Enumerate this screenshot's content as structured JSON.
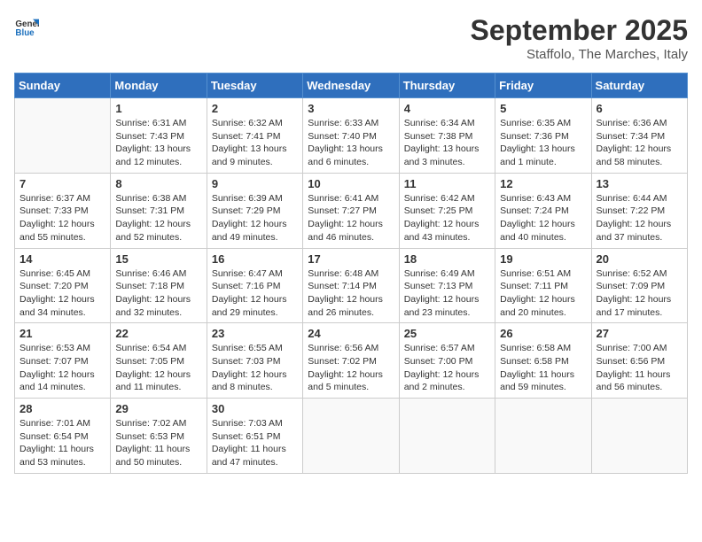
{
  "logo": {
    "general": "General",
    "blue": "Blue"
  },
  "header": {
    "month": "September 2025",
    "location": "Staffolo, The Marches, Italy"
  },
  "weekdays": [
    "Sunday",
    "Monday",
    "Tuesday",
    "Wednesday",
    "Thursday",
    "Friday",
    "Saturday"
  ],
  "weeks": [
    [
      {
        "day": "",
        "sunrise": "",
        "sunset": "",
        "daylight": ""
      },
      {
        "day": "1",
        "sunrise": "Sunrise: 6:31 AM",
        "sunset": "Sunset: 7:43 PM",
        "daylight": "Daylight: 13 hours and 12 minutes."
      },
      {
        "day": "2",
        "sunrise": "Sunrise: 6:32 AM",
        "sunset": "Sunset: 7:41 PM",
        "daylight": "Daylight: 13 hours and 9 minutes."
      },
      {
        "day": "3",
        "sunrise": "Sunrise: 6:33 AM",
        "sunset": "Sunset: 7:40 PM",
        "daylight": "Daylight: 13 hours and 6 minutes."
      },
      {
        "day": "4",
        "sunrise": "Sunrise: 6:34 AM",
        "sunset": "Sunset: 7:38 PM",
        "daylight": "Daylight: 13 hours and 3 minutes."
      },
      {
        "day": "5",
        "sunrise": "Sunrise: 6:35 AM",
        "sunset": "Sunset: 7:36 PM",
        "daylight": "Daylight: 13 hours and 1 minute."
      },
      {
        "day": "6",
        "sunrise": "Sunrise: 6:36 AM",
        "sunset": "Sunset: 7:34 PM",
        "daylight": "Daylight: 12 hours and 58 minutes."
      }
    ],
    [
      {
        "day": "7",
        "sunrise": "Sunrise: 6:37 AM",
        "sunset": "Sunset: 7:33 PM",
        "daylight": "Daylight: 12 hours and 55 minutes."
      },
      {
        "day": "8",
        "sunrise": "Sunrise: 6:38 AM",
        "sunset": "Sunset: 7:31 PM",
        "daylight": "Daylight: 12 hours and 52 minutes."
      },
      {
        "day": "9",
        "sunrise": "Sunrise: 6:39 AM",
        "sunset": "Sunset: 7:29 PM",
        "daylight": "Daylight: 12 hours and 49 minutes."
      },
      {
        "day": "10",
        "sunrise": "Sunrise: 6:41 AM",
        "sunset": "Sunset: 7:27 PM",
        "daylight": "Daylight: 12 hours and 46 minutes."
      },
      {
        "day": "11",
        "sunrise": "Sunrise: 6:42 AM",
        "sunset": "Sunset: 7:25 PM",
        "daylight": "Daylight: 12 hours and 43 minutes."
      },
      {
        "day": "12",
        "sunrise": "Sunrise: 6:43 AM",
        "sunset": "Sunset: 7:24 PM",
        "daylight": "Daylight: 12 hours and 40 minutes."
      },
      {
        "day": "13",
        "sunrise": "Sunrise: 6:44 AM",
        "sunset": "Sunset: 7:22 PM",
        "daylight": "Daylight: 12 hours and 37 minutes."
      }
    ],
    [
      {
        "day": "14",
        "sunrise": "Sunrise: 6:45 AM",
        "sunset": "Sunset: 7:20 PM",
        "daylight": "Daylight: 12 hours and 34 minutes."
      },
      {
        "day": "15",
        "sunrise": "Sunrise: 6:46 AM",
        "sunset": "Sunset: 7:18 PM",
        "daylight": "Daylight: 12 hours and 32 minutes."
      },
      {
        "day": "16",
        "sunrise": "Sunrise: 6:47 AM",
        "sunset": "Sunset: 7:16 PM",
        "daylight": "Daylight: 12 hours and 29 minutes."
      },
      {
        "day": "17",
        "sunrise": "Sunrise: 6:48 AM",
        "sunset": "Sunset: 7:14 PM",
        "daylight": "Daylight: 12 hours and 26 minutes."
      },
      {
        "day": "18",
        "sunrise": "Sunrise: 6:49 AM",
        "sunset": "Sunset: 7:13 PM",
        "daylight": "Daylight: 12 hours and 23 minutes."
      },
      {
        "day": "19",
        "sunrise": "Sunrise: 6:51 AM",
        "sunset": "Sunset: 7:11 PM",
        "daylight": "Daylight: 12 hours and 20 minutes."
      },
      {
        "day": "20",
        "sunrise": "Sunrise: 6:52 AM",
        "sunset": "Sunset: 7:09 PM",
        "daylight": "Daylight: 12 hours and 17 minutes."
      }
    ],
    [
      {
        "day": "21",
        "sunrise": "Sunrise: 6:53 AM",
        "sunset": "Sunset: 7:07 PM",
        "daylight": "Daylight: 12 hours and 14 minutes."
      },
      {
        "day": "22",
        "sunrise": "Sunrise: 6:54 AM",
        "sunset": "Sunset: 7:05 PM",
        "daylight": "Daylight: 12 hours and 11 minutes."
      },
      {
        "day": "23",
        "sunrise": "Sunrise: 6:55 AM",
        "sunset": "Sunset: 7:03 PM",
        "daylight": "Daylight: 12 hours and 8 minutes."
      },
      {
        "day": "24",
        "sunrise": "Sunrise: 6:56 AM",
        "sunset": "Sunset: 7:02 PM",
        "daylight": "Daylight: 12 hours and 5 minutes."
      },
      {
        "day": "25",
        "sunrise": "Sunrise: 6:57 AM",
        "sunset": "Sunset: 7:00 PM",
        "daylight": "Daylight: 12 hours and 2 minutes."
      },
      {
        "day": "26",
        "sunrise": "Sunrise: 6:58 AM",
        "sunset": "Sunset: 6:58 PM",
        "daylight": "Daylight: 11 hours and 59 minutes."
      },
      {
        "day": "27",
        "sunrise": "Sunrise: 7:00 AM",
        "sunset": "Sunset: 6:56 PM",
        "daylight": "Daylight: 11 hours and 56 minutes."
      }
    ],
    [
      {
        "day": "28",
        "sunrise": "Sunrise: 7:01 AM",
        "sunset": "Sunset: 6:54 PM",
        "daylight": "Daylight: 11 hours and 53 minutes."
      },
      {
        "day": "29",
        "sunrise": "Sunrise: 7:02 AM",
        "sunset": "Sunset: 6:53 PM",
        "daylight": "Daylight: 11 hours and 50 minutes."
      },
      {
        "day": "30",
        "sunrise": "Sunrise: 7:03 AM",
        "sunset": "Sunset: 6:51 PM",
        "daylight": "Daylight: 11 hours and 47 minutes."
      },
      {
        "day": "",
        "sunrise": "",
        "sunset": "",
        "daylight": ""
      },
      {
        "day": "",
        "sunrise": "",
        "sunset": "",
        "daylight": ""
      },
      {
        "day": "",
        "sunrise": "",
        "sunset": "",
        "daylight": ""
      },
      {
        "day": "",
        "sunrise": "",
        "sunset": "",
        "daylight": ""
      }
    ]
  ]
}
